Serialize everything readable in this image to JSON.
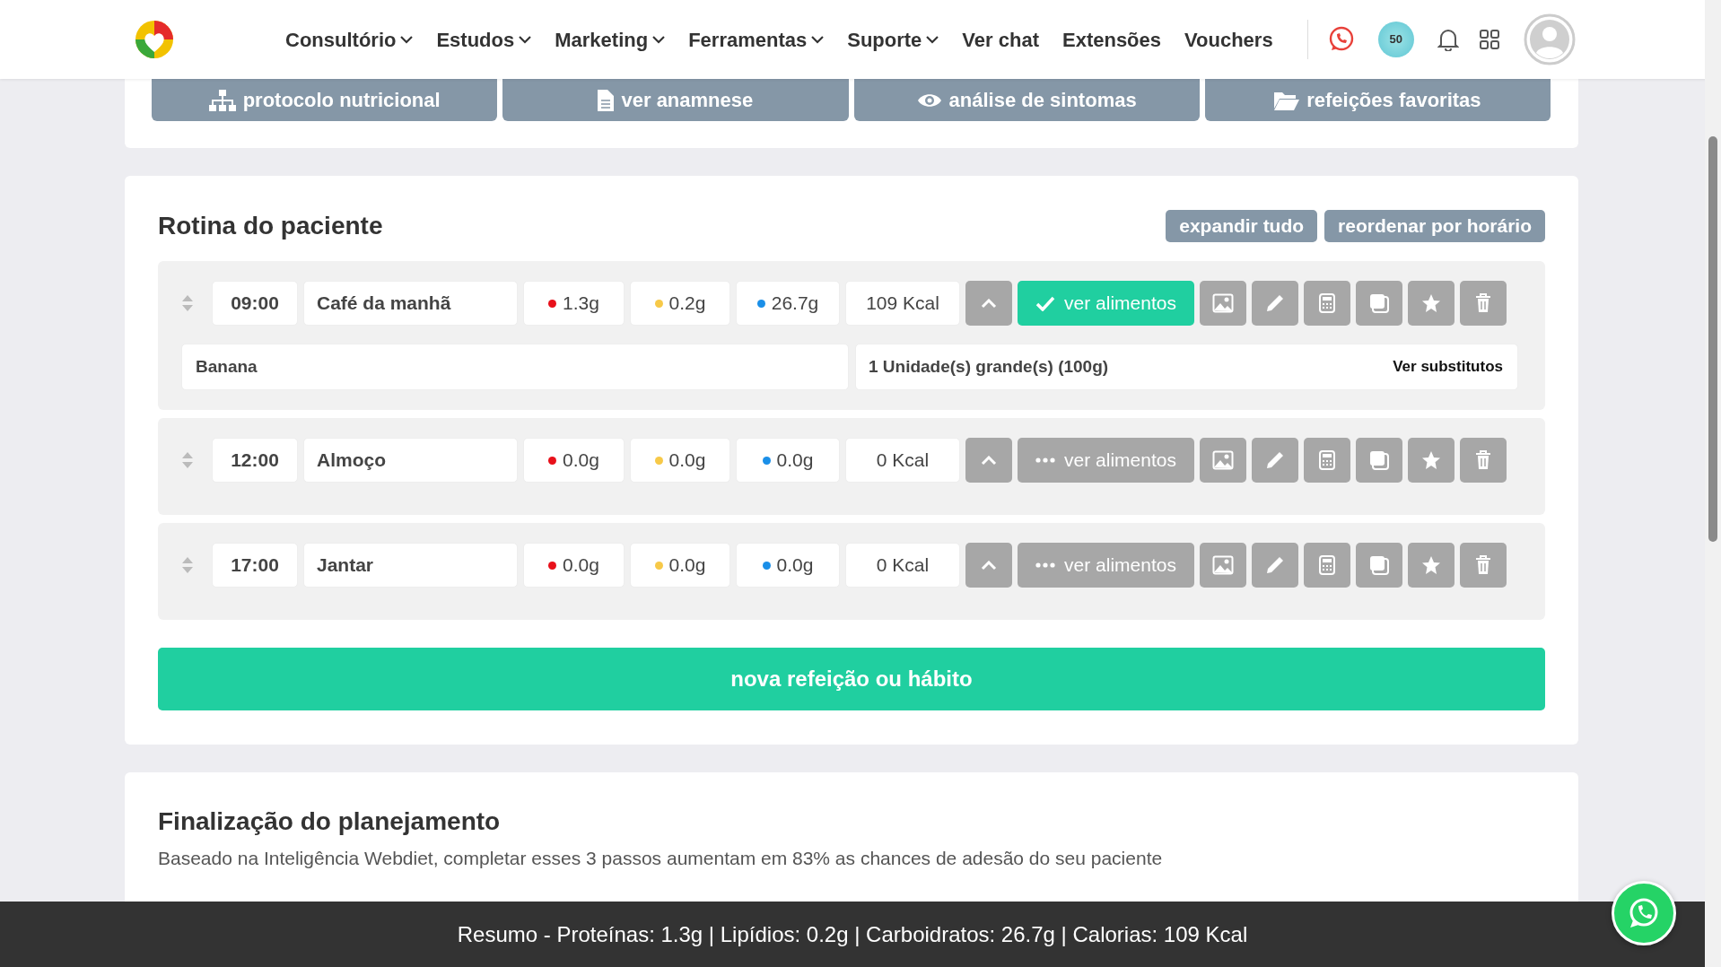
{
  "nav": {
    "items": [
      {
        "label": "Consultório",
        "dropdown": true
      },
      {
        "label": "Estudos",
        "dropdown": true
      },
      {
        "label": "Marketing",
        "dropdown": true
      },
      {
        "label": "Ferramentas",
        "dropdown": true
      },
      {
        "label": "Suporte",
        "dropdown": true
      },
      {
        "label": "Ver chat",
        "dropdown": false
      },
      {
        "label": "Extensões",
        "dropdown": false
      },
      {
        "label": "Vouchers",
        "dropdown": false
      }
    ],
    "badge": "50"
  },
  "top_buttons": [
    {
      "kind": "protocol",
      "label": "protocolo nutricional"
    },
    {
      "kind": "document",
      "label": "ver anamnese"
    },
    {
      "kind": "eye",
      "label": "análise de sintomas"
    },
    {
      "kind": "folder",
      "label": "refeições favoritas"
    }
  ],
  "routine": {
    "title": "Rotina do paciente",
    "actions": [
      "expandir tudo",
      "reordenar por horário"
    ],
    "meals": [
      {
        "time": "09:00",
        "name": "Café da manhã",
        "protein": "1.3g",
        "lipids": "0.2g",
        "carbs": "26.7g",
        "kcal": "109 Kcal",
        "button": "ver alimentos",
        "foods_shown": true,
        "foods": [
          {
            "name": "Banana",
            "quantity": "1 Unidade(s) grande(s) (100g)",
            "link": "Ver substitutos"
          }
        ]
      },
      {
        "time": "12:00",
        "name": "Almoço",
        "protein": "0.0g",
        "lipids": "0.0g",
        "carbs": "0.0g",
        "kcal": "0 Kcal",
        "button": "ver alimentos",
        "foods_shown": false
      },
      {
        "time": "17:00",
        "name": "Jantar",
        "protein": "0.0g",
        "lipids": "0.0g",
        "carbs": "0.0g",
        "kcal": "0 Kcal",
        "button": "ver alimentos",
        "foods_shown": false
      }
    ],
    "add_button": "nova refeição ou hábito"
  },
  "finalization": {
    "title": "Finalização do planejamento",
    "text": "Baseado na Inteligência Webdiet, completar esses 3 passos aumentam em 83% as chances de adesão do seu paciente"
  },
  "summary": "Resumo - Proteínas: 1.3g | Lipídios: 0.2g | Carboidratos: 26.7g | Calorias: 109 Kcal"
}
